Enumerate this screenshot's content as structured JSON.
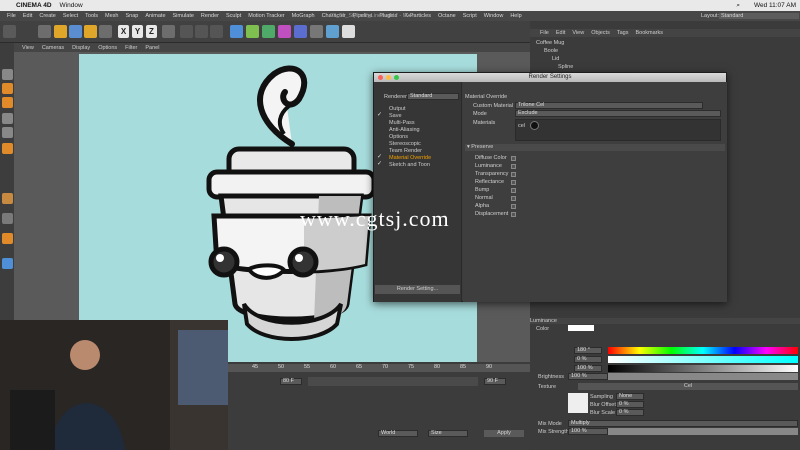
{
  "mac_menu": {
    "app": "CINEMA 4D",
    "items": [
      "Window"
    ],
    "clock": "Wed 11:07 AM"
  },
  "c4d_menu": {
    "items": [
      "File",
      "Edit",
      "Create",
      "Select",
      "Tools",
      "Mesh",
      "Snap",
      "Animate",
      "Simulate",
      "Render",
      "Sculpt",
      "Motion Tracker",
      "MoGraph",
      "Character",
      "Pipeline",
      "Plugins",
      "X-Particles",
      "Octane",
      "Script",
      "Window",
      "Help"
    ],
    "doc_title": "03_01_Stylized_Lines.c4d * - Main",
    "layout_label": "Layout:",
    "layout_value": "Standard"
  },
  "viewport_menu": [
    "View",
    "Cameras",
    "Display",
    "Options",
    "Filter",
    "Panel"
  ],
  "toolbar": {
    "x": "X",
    "y": "Y",
    "z": "Z"
  },
  "object_manager": {
    "menu": [
      "File",
      "Edit",
      "View",
      "Objects",
      "Tags",
      "Bookmarks"
    ],
    "items": [
      "Coffee Mug",
      "Boole",
      "Lid",
      "Spline"
    ]
  },
  "render_settings": {
    "title": "Render Settings",
    "renderer_label": "Renderer",
    "renderer_value": "Standard",
    "sections": [
      {
        "label": "Output",
        "checked": ""
      },
      {
        "label": "Save",
        "checked": "✓"
      },
      {
        "label": "Multi-Pass",
        "checked": ""
      },
      {
        "label": "Anti-Aliasing",
        "checked": ""
      },
      {
        "label": "Options",
        "checked": ""
      },
      {
        "label": "Stereoscopic",
        "checked": ""
      },
      {
        "label": "Team Render",
        "checked": ""
      },
      {
        "label": "Material Override",
        "checked": "✓"
      },
      {
        "label": "Sketch and Toon",
        "checked": "✓"
      }
    ],
    "panel_title": "Material Override",
    "custom_material_label": "Custom Material",
    "custom_material_value": "Trilone Cel",
    "mode_label": "Mode",
    "mode_value": "Exclude",
    "materials_label": "Materials",
    "materials_value": "cel",
    "preserve_header": "▾ Preserve",
    "preserve_items": [
      "Diffuse Color",
      "Luminance",
      "Transparency",
      "Reflectance",
      "Bump",
      "Normal",
      "Alpha",
      "Displacement"
    ],
    "button": "Render Setting..."
  },
  "timeline": {
    "ticks": [
      "45",
      "50",
      "55",
      "60",
      "65",
      "70",
      "75",
      "80",
      "85",
      "90"
    ],
    "frame_left": "80 F",
    "frame_right": "90 F",
    "apply": "Apply",
    "world": "World",
    "size": "Size"
  },
  "attributes": {
    "luminance_title": "Luminance",
    "color_label": "Color",
    "h_label": "H",
    "h_value": "180 °",
    "s_label": "S",
    "s_value": "0 %",
    "v_label": "V",
    "v_value": "100 %",
    "brightness_label": "Brightness",
    "brightness_value": "100 %",
    "texture_label": "Texture",
    "texture_value": "Cel",
    "sampling_label": "Sampling",
    "sampling_value": "None",
    "blur_offset_label": "Blur Offset",
    "blur_offset_value": "0 %",
    "blur_scale_label": "Blur Scale",
    "blur_scale_value": "0 %",
    "mix_mode_label": "Mix Mode",
    "mix_mode_value": "Multiply",
    "mix_strength_label": "Mix Strength",
    "mix_strength_value": "100 %"
  },
  "watermark": "www.cgtsj.com",
  "colors": {
    "accent": "#f0a000",
    "canvas": "#a7dcdc",
    "panel": "#3c3c3c"
  }
}
